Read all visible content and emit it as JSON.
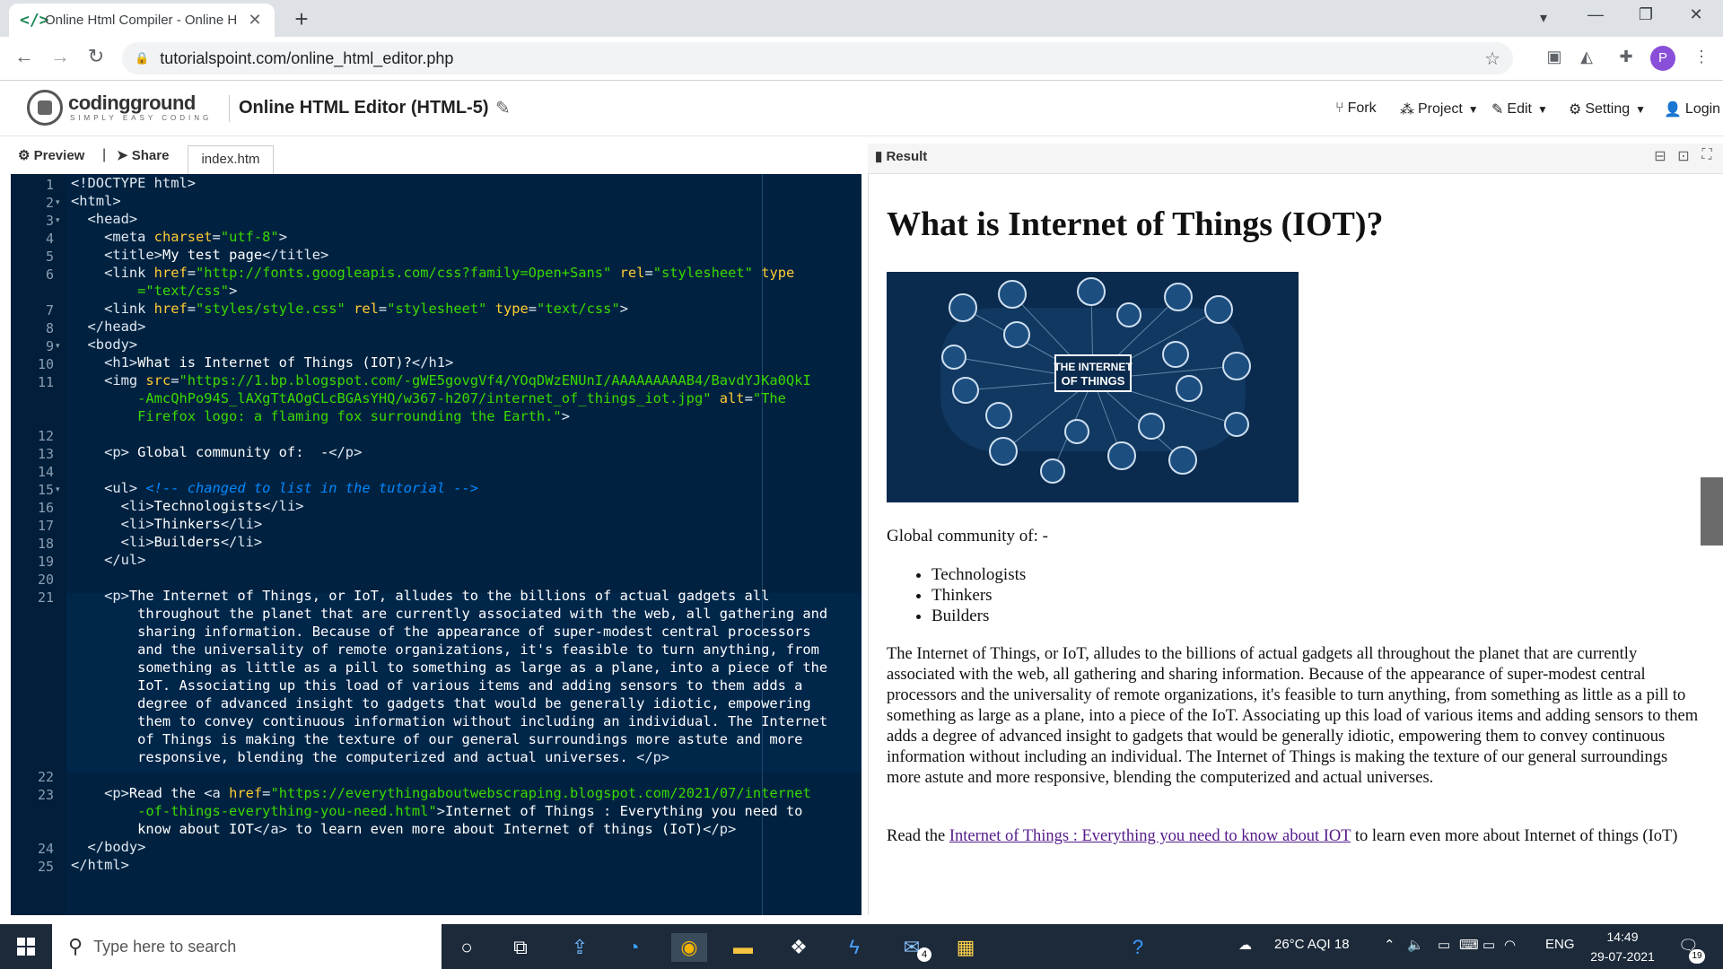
{
  "browser": {
    "tab_title": "Online Html Compiler - Online H",
    "favicon": "</>",
    "url": "tutorialspoint.com/online_html_editor.php",
    "avatar_letter": "P"
  },
  "site": {
    "logo_text": "codingground",
    "logo_sub": "SIMPLY EASY CODING",
    "page_title": "Online HTML Editor (HTML-5)",
    "menu": {
      "fork": "Fork",
      "project": "Project",
      "edit": "Edit",
      "setting": "Setting",
      "login": "Login"
    }
  },
  "editor": {
    "preview": "Preview",
    "share": "Share",
    "filename": "index.htm",
    "line_numbers": [
      "1",
      "2",
      "3",
      "4",
      "5",
      "6",
      "7",
      "8",
      "9",
      "10",
      "11",
      "12",
      "13",
      "14",
      "15",
      "16",
      "17",
      "18",
      "19",
      "20",
      "21",
      "22",
      "23",
      "24",
      "25"
    ],
    "folds": [
      "2",
      "3",
      "9",
      "15"
    ]
  },
  "result": {
    "label": "Result",
    "heading": "What is Internet of Things (IOT)?",
    "image_caption_1": "THE INTERNET",
    "image_caption_2": "OF THINGS",
    "community": "Global community of: -",
    "list": [
      "Technologists",
      "Thinkers",
      "Builders"
    ],
    "paragraph": "The Internet of Things, or IoT, alludes to the billions of actual gadgets all throughout the planet that are currently associated with the web, all gathering and sharing information. Because of the appearance of super-modest central processors and the universality of remote organizations, it's feasible to turn anything, from something as little as a pill to something as large as a plane, into a piece of the IoT. Associating up this load of various items and adding sensors to them adds a degree of advanced insight to gadgets that would be generally idiotic, empowering them to convey continuous information without including an individual. The Internet of Things is making the texture of our general surroundings more astute and more responsive, blending the computerized and actual universes.",
    "read_prefix": "Read the ",
    "read_link": "Internet of Things : Everything you need to know about IOT",
    "read_suffix": " to learn even more about Internet of things (IoT)"
  },
  "taskbar": {
    "search_placeholder": "Type here to search",
    "weather": "26°C AQI 18",
    "lang": "ENG",
    "time": "14:49",
    "date": "29-07-2021",
    "mail_badge": "4",
    "notif_badge": "19"
  },
  "colors": {
    "editor_bg": "#002240",
    "tag": "#e0e8f2",
    "attr": "#ffcc33",
    "value": "#3ad900",
    "comment": "#0088ff"
  }
}
